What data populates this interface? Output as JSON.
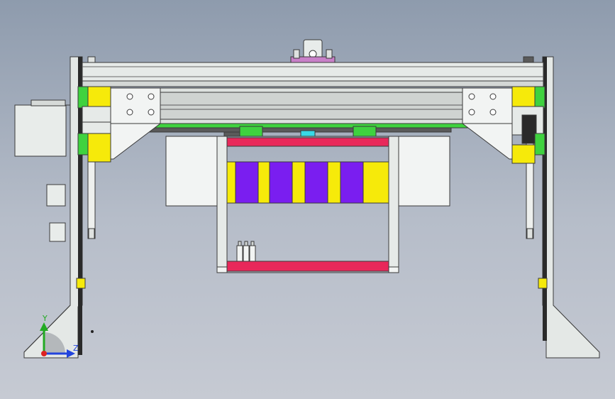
{
  "viewport": {
    "background_top": "#8e9bad",
    "background_bottom": "#c6cad3"
  },
  "colors": {
    "frame_fill": "#e4e8e6",
    "frame_stroke": "#3a3a3a",
    "yellow_block": "#f6ea0a",
    "green_block": "#3fd23f",
    "red_bar": "#e8285a",
    "purple_block": "#7a1ef0",
    "cyan_tab": "#38d8e6",
    "pink_plate": "#c880c8",
    "axis_y": "#22aa22",
    "axis_z": "#2244dd",
    "axis_origin": "#dd2222"
  },
  "triad": {
    "y_label": "Y",
    "z_label": "Z"
  },
  "icons": {
    "triad": "coordinate-triad-icon"
  }
}
